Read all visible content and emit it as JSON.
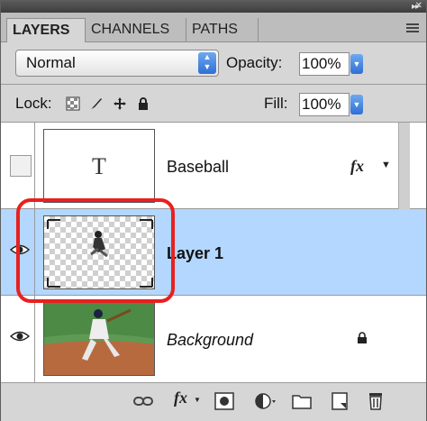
{
  "tabs": [
    {
      "label": "LAYERS",
      "active": true
    },
    {
      "label": "CHANNELS",
      "active": false
    },
    {
      "label": "PATHS",
      "active": false
    }
  ],
  "blend_mode": "Normal",
  "opacity": {
    "label": "Opacity:",
    "value": "100%"
  },
  "lock": {
    "label": "Lock:",
    "icons": [
      "lock-transparent-icon",
      "lock-image-icon",
      "lock-position-icon",
      "lock-all-icon"
    ]
  },
  "fill": {
    "label": "Fill:",
    "value": "100%"
  },
  "layers": [
    {
      "name": "Baseball",
      "type": "text",
      "thumb_glyph": "T",
      "visible": false,
      "has_fx": true,
      "fx_label": "fx",
      "selected": false,
      "italic": false
    },
    {
      "name": "Layer 1",
      "type": "pixel",
      "visible": true,
      "selected": true,
      "italic": false
    },
    {
      "name": "Background",
      "type": "image",
      "visible": true,
      "locked": true,
      "selected": false,
      "italic": true
    }
  ],
  "colors": {
    "selection": "#b3d7ff",
    "highlight": "#e8201f",
    "panel": "#d6d6d6",
    "accent": "#2f6fd6"
  },
  "bottom_icons": [
    "link-icon",
    "fx-icon",
    "mask-icon",
    "adjustment-icon",
    "group-folder-icon",
    "new-layer-icon",
    "trash-icon"
  ],
  "bottom_fx_label": "fx"
}
